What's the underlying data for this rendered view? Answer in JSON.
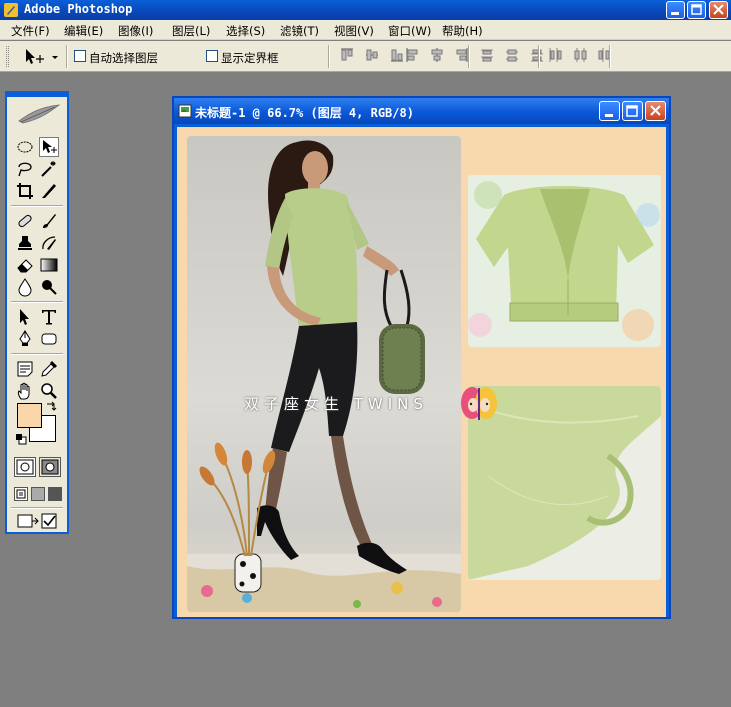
{
  "app": {
    "title": "Adobe Photoshop"
  },
  "menu": [
    "文件(F)",
    "编辑(E)",
    "图像(I)",
    "图层(L)",
    "选择(S)",
    "滤镜(T)",
    "视图(V)",
    "窗口(W)",
    "帮助(H)"
  ],
  "options": {
    "auto_select_layer": "自动选择图层",
    "show_bounding_box": "显示定界框"
  },
  "document": {
    "title": "未标题-1 @ 66.7% (图层 4, RGB/8)",
    "watermark_text": "双子座女生 TWINS"
  },
  "colors": {
    "foreground": "#f9d7ab",
    "background": "#ffffff",
    "titlebar": "#0a5fd8",
    "workspace": "#7f7f7f",
    "canvas_bg": "#f8d9ae"
  },
  "tools": [
    "marquee-icon",
    "move-icon",
    "lasso-icon",
    "magic-wand-icon",
    "crop-icon",
    "slice-icon",
    "healing-brush-icon",
    "brush-icon",
    "clone-stamp-icon",
    "history-brush-icon",
    "eraser-icon",
    "gradient-icon",
    "blur-icon",
    "dodge-icon",
    "path-select-icon",
    "type-icon",
    "pen-icon",
    "rectangle-shape-icon",
    "notes-icon",
    "eyedropper-icon",
    "hand-icon",
    "zoom-icon"
  ]
}
